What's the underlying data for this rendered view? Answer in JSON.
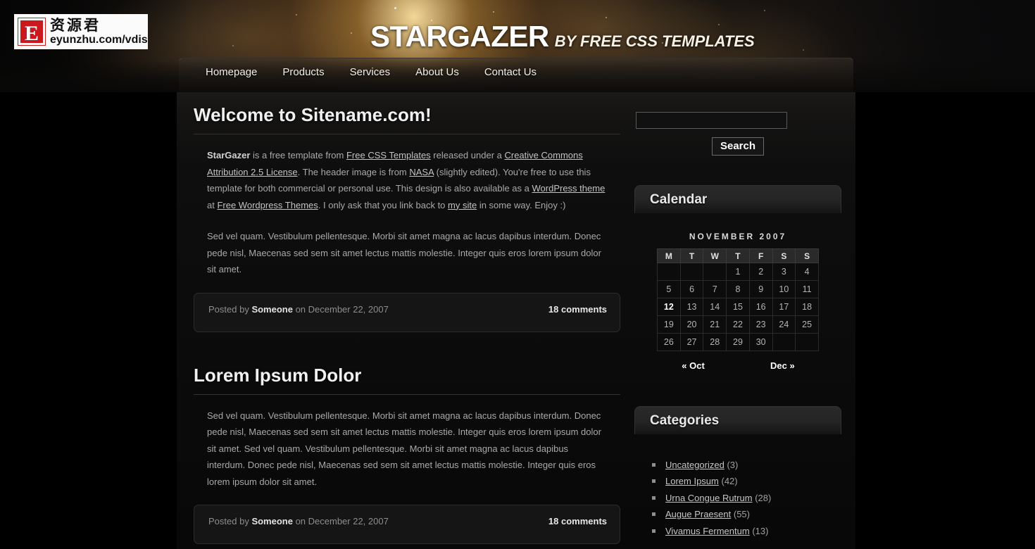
{
  "watermark": {
    "badge_letter": "E",
    "cn_text": "资源君",
    "url_text": "eyunzhu.com/vdisk"
  },
  "header": {
    "site_title": "STARGAZER",
    "tagline": "BY FREE CSS TEMPLATES"
  },
  "nav": {
    "items": [
      {
        "label": "Homepage"
      },
      {
        "label": "Products"
      },
      {
        "label": "Services"
      },
      {
        "label": "About Us"
      },
      {
        "label": "Contact Us"
      }
    ]
  },
  "posts": [
    {
      "title": "Welcome to Sitename.com!",
      "paragraph1": {
        "lead": "StarGazer",
        "t1": " is a free template from ",
        "link1": "Free CSS Templates",
        "t2": " released under a ",
        "link2": "Creative Commons Attribution 2.5 License",
        "t3": ". The header image is from ",
        "link3": "NASA",
        "t4": " (slightly edited). You're free to use this template for both commercial or personal use. This design is also available as a ",
        "link4": "WordPress theme",
        "t5": " at ",
        "link5": "Free Wordpress Themes",
        "t6": ". I only ask that you link back to ",
        "link6": "my site",
        "t7": " in some way. Enjoy :)"
      },
      "paragraph2": "Sed vel quam. Vestibulum pellentesque. Morbi sit amet magna ac lacus dapibus interdum. Donec pede nisl, Maecenas sed sem sit amet lectus mattis molestie. Integer quis eros lorem ipsum dolor sit amet.",
      "meta": {
        "posted_by_prefix": "Posted by ",
        "author": "Someone",
        "date_prefix": " on ",
        "date": "December 22, 2007",
        "comments": "18 comments"
      }
    },
    {
      "title": "Lorem Ipsum Dolor",
      "paragraph1": "Sed vel quam. Vestibulum pellentesque. Morbi sit amet magna ac lacus dapibus interdum. Donec pede nisl, Maecenas sed sem sit amet lectus mattis molestie. Integer quis eros lorem ipsum dolor sit amet. Sed vel quam. Vestibulum pellentesque. Morbi sit amet magna ac lacus dapibus interdum. Donec pede nisl, Maecenas sed sem sit amet lectus mattis molestie. Integer quis eros lorem ipsum dolor sit amet.",
      "meta": {
        "posted_by_prefix": "Posted by ",
        "author": "Someone",
        "date_prefix": " on ",
        "date": "December 22, 2007",
        "comments": "18 comments"
      }
    }
  ],
  "sidebar": {
    "search": {
      "value": "",
      "placeholder": "",
      "button_label": "Search"
    },
    "calendar": {
      "widget_title": "Calendar",
      "caption": "NOVEMBER 2007",
      "weekdays": [
        "M",
        "T",
        "W",
        "T",
        "F",
        "S",
        "S"
      ],
      "lead_blanks": 3,
      "days": [
        1,
        2,
        3,
        4,
        5,
        6,
        7,
        8,
        9,
        10,
        11,
        12,
        13,
        14,
        15,
        16,
        17,
        18,
        19,
        20,
        21,
        22,
        23,
        24,
        25,
        26,
        27,
        28,
        29,
        30
      ],
      "today": 12,
      "prev_label": "« Oct",
      "next_label": "Dec »"
    },
    "categories": {
      "widget_title": "Categories",
      "items": [
        {
          "label": "Uncategorized",
          "count": "(3)"
        },
        {
          "label": "Lorem Ipsum",
          "count": "(42)"
        },
        {
          "label": "Urna Congue Rutrum",
          "count": "(28)"
        },
        {
          "label": "Augue Praesent",
          "count": "(55)"
        },
        {
          "label": "Vivamus Fermentum",
          "count": "(13)"
        }
      ]
    }
  },
  "colors": {
    "page_background": "#000000",
    "wrapper_background": "#0c0c0c",
    "accent_star": "#ffe2a0",
    "text_primary": "#f0f0f0",
    "text_body": "#a9a9a9",
    "link": "#c6c6c6"
  }
}
